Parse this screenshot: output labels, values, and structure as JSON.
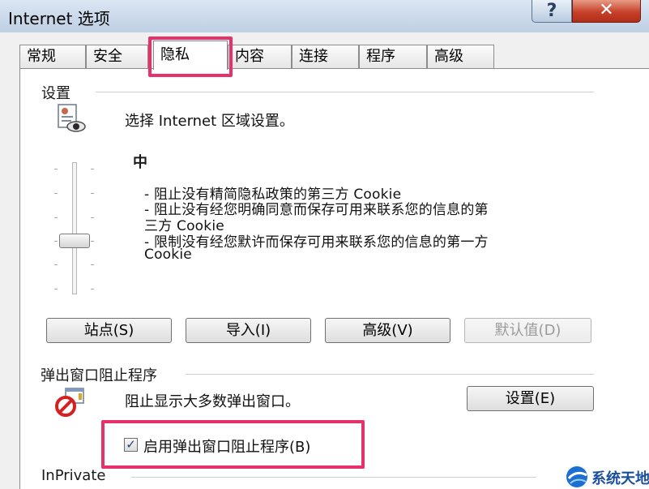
{
  "window": {
    "title": "Internet 选项",
    "help_label": "?",
    "close_label": "✕"
  },
  "tabs": [
    {
      "label": "常规"
    },
    {
      "label": "安全"
    },
    {
      "label": "隐私",
      "active": true
    },
    {
      "label": "内容"
    },
    {
      "label": "连接"
    },
    {
      "label": "程序"
    },
    {
      "label": "高级"
    }
  ],
  "settings": {
    "group_label": "设置",
    "zone_text": "选择 Internet 区域设置。",
    "level": "中",
    "description_lines": [
      "- 阻止没有精简隐私政策的第三方 Cookie",
      "- 阻止没有经您明确同意而保存可用来联系您的信息的第",
      "三方 Cookie",
      "- 限制没有经您默许而保存可用来联系您的信息的第一方",
      "Cookie"
    ],
    "buttons": {
      "sites": "站点(S)",
      "import": "导入(I)",
      "advanced": "高级(V)",
      "default": "默认值(D)"
    }
  },
  "popup": {
    "group_label": "弹出窗口阻止程序",
    "text": "阻止显示大多数弹出窗口。",
    "settings_button": "设置(E)",
    "checkbox_label": "启用弹出窗口阻止程序(B)",
    "checkbox_checked": true
  },
  "inprivate": {
    "group_label": "InPrivate"
  },
  "watermark": {
    "text": "系统天地"
  },
  "colors": {
    "highlight": "#e8306a",
    "titlebar": "#c9d8ea",
    "close": "#c7412a"
  },
  "icons": {
    "settings_icon": "privacy-eye-icon",
    "popup_icon": "popup-blocker-icon"
  }
}
